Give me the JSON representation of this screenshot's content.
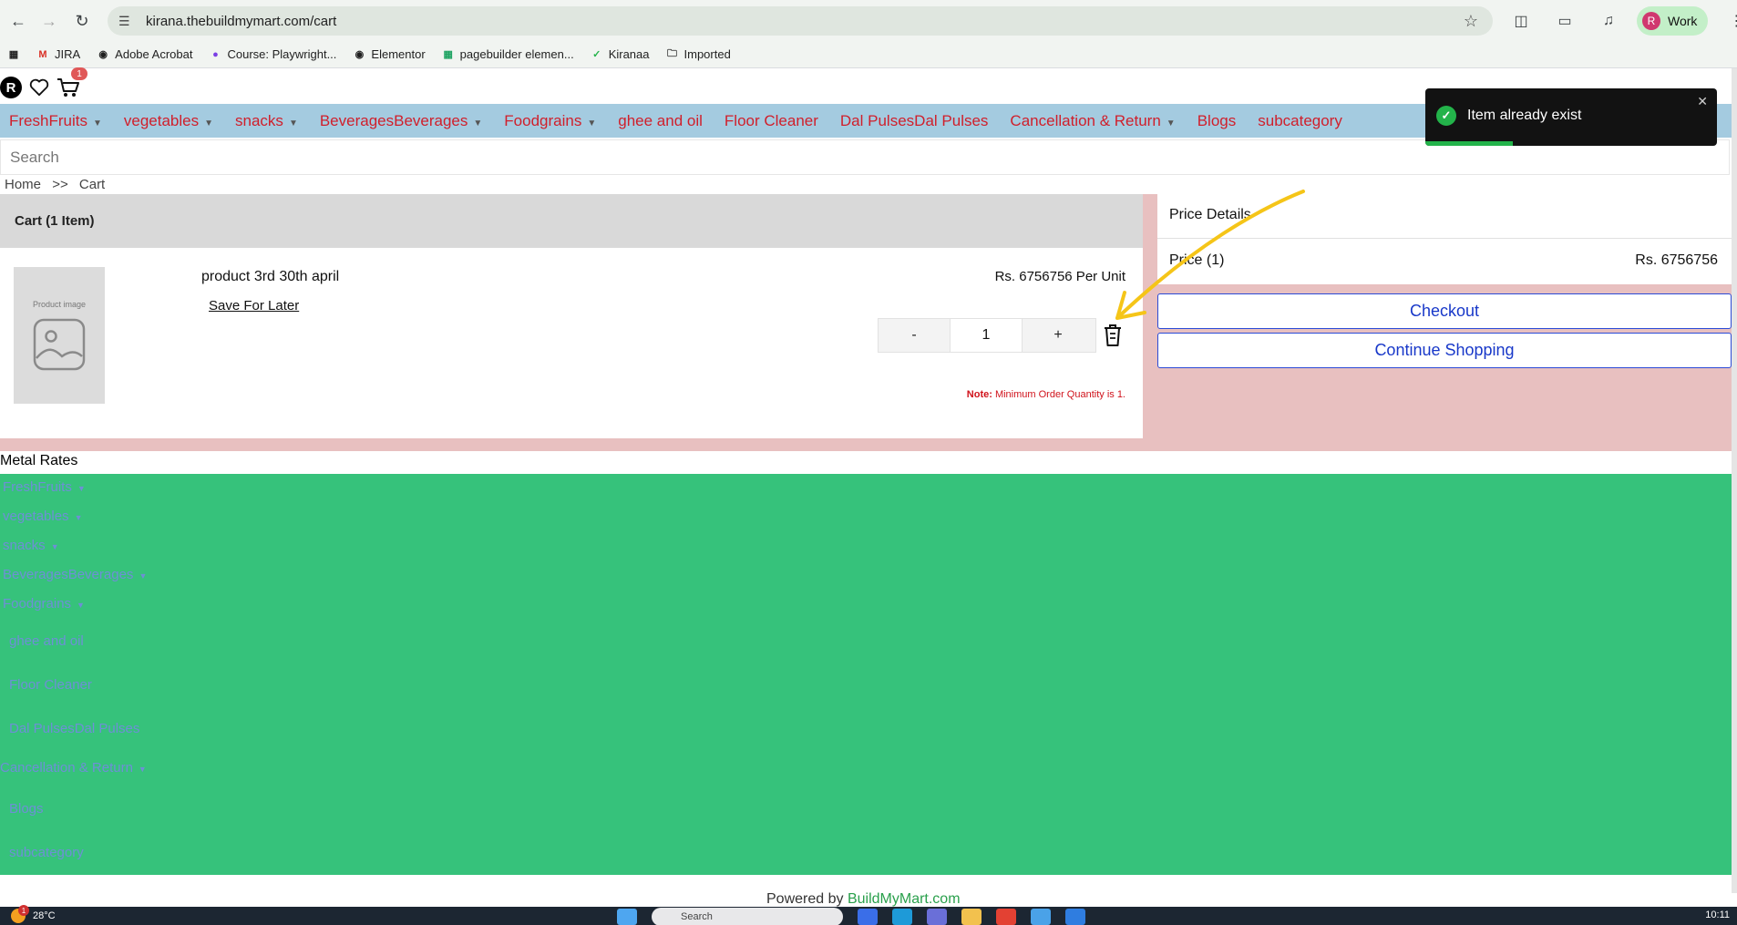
{
  "browser": {
    "url": "kirana.thebuildmymart.com/cart",
    "profile_initial": "R",
    "profile_label": "Work",
    "bookmarks": [
      "JIRA",
      "Adobe Acrobat",
      "Course: Playwright...",
      "Elementor",
      "pagebuilder elemen...",
      "Kiranaa",
      "Imported"
    ]
  },
  "header": {
    "user_initial": "R",
    "cart_count": "1"
  },
  "menu": {
    "items": [
      "FreshFruits",
      "vegetables",
      "snacks",
      "BeveragesBeverages",
      "Foodgrains",
      "ghee and oil",
      "Floor Cleaner",
      "Dal PulsesDal Pulses",
      "Cancellation & Return",
      "Blogs",
      "subcategory"
    ]
  },
  "search": {
    "placeholder": "Search"
  },
  "breadcrumb": {
    "home": "Home",
    "sep": ">>",
    "current": "Cart"
  },
  "cart": {
    "title": "Cart (1 Item)",
    "product_image_caption": "Product image",
    "product_name": "product 3rd 30th april",
    "save_for_later": "Save For Later",
    "unit_price": "Rs. 6756756 Per Unit",
    "qty_minus": "-",
    "qty_value": "1",
    "qty_plus": "+",
    "note_label": "Note:",
    "note_text": "Minimum Order Quantity is 1."
  },
  "price": {
    "title": "Price Details",
    "label": "Price (1)",
    "value": "Rs. 6756756",
    "checkout": "Checkout",
    "continue": "Continue Shopping"
  },
  "toast": {
    "message": "Item already exist",
    "progress": 0.3
  },
  "footer": {
    "metal_rates": "Metal Rates",
    "links": [
      "FreshFruits",
      "vegetables",
      "snacks",
      "BeveragesBeverages",
      "Foodgrains",
      "ghee and oil",
      "Floor Cleaner",
      "Dal PulsesDal Pulses",
      "Cancellation & Return",
      "Blogs",
      "subcategory"
    ],
    "powered_prefix": "Powered by",
    "powered_link": "BuildMyMart.com"
  },
  "taskbar": {
    "weather": "28°C",
    "weather_badge": "1",
    "search_placeholder": "Search",
    "clock": "10:11"
  },
  "colors": {
    "menu_bg": "#a4cbe0",
    "menu_text": "#d01f2b",
    "cart_area_bg": "#e8c0c0",
    "footer_bg": "#36c27b",
    "button_blue": "#1838c9",
    "toast_bg": "#121212",
    "success": "#23b34a",
    "annotation_arrow": "#f5c518"
  }
}
